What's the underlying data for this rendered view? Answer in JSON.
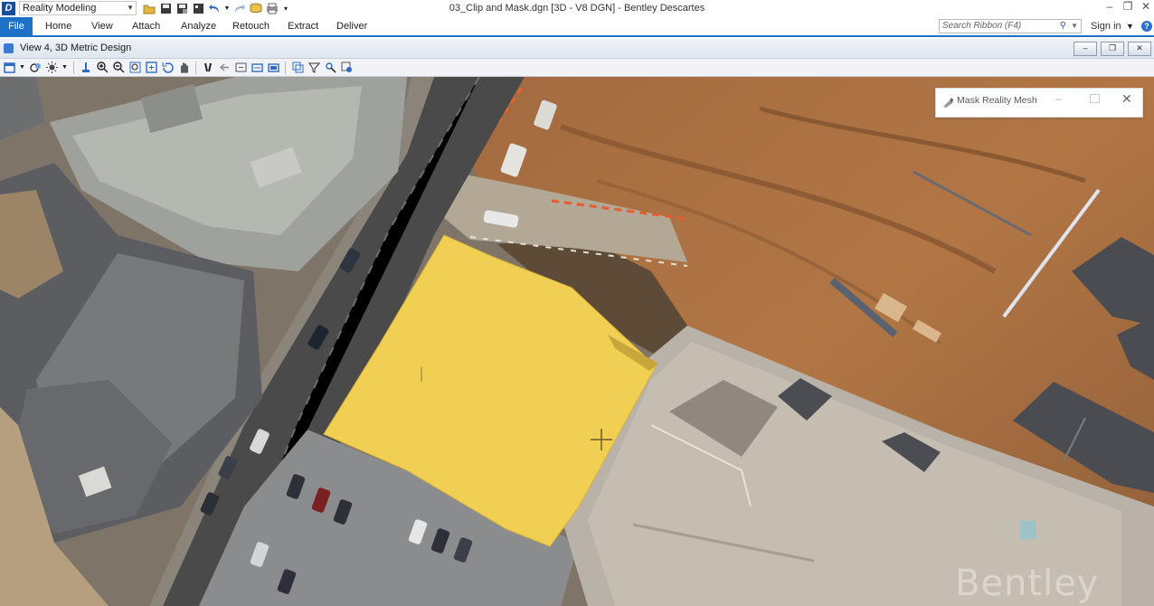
{
  "window": {
    "title": "03_Clip and Mask.dgn [3D - V8 DGN] - Bentley Descartes",
    "workflow": "Reality Modeling",
    "controls": [
      "minimize",
      "restore",
      "close"
    ]
  },
  "ribbon": {
    "tabs": [
      "File",
      "Home",
      "View",
      "Attach",
      "Analyze",
      "Retouch",
      "Extract",
      "Deliver"
    ],
    "active_tab": "File",
    "search_placeholder": "Search Ribbon (F4)",
    "sign_in": "Sign in"
  },
  "view": {
    "title": "View 4, 3D Metric Design"
  },
  "dialog": {
    "title": "Mask Reality Mesh"
  },
  "watermark": "Bentley",
  "colors": {
    "accent": "#1d72c8",
    "mask_fill": "#f1cf52",
    "terrain": "#a8703f"
  },
  "icons": {
    "quick_access": [
      "folder-open-icon",
      "save-icon",
      "save-as-icon",
      "properties-icon",
      "undo-icon",
      "undo-dropdown-icon",
      "redo-icon",
      "stack-icon",
      "print-icon",
      "customize-icon"
    ],
    "view_tools": [
      "view-attributes-icon",
      "display-style-icon",
      "lighting-icon",
      "dropdown-icon",
      "place-marker-icon",
      "zoom-in-icon",
      "zoom-out-icon",
      "zoom-window-icon",
      "fit-view-icon",
      "rotate-view-icon",
      "pan-icon",
      "walk-icon",
      "previous-view-icon",
      "next-view-icon",
      "copy-view-icon",
      "camera-icon",
      "window-area-icon",
      "clip-volume-icon",
      "filter-icon",
      "navigate-icon",
      "toggle-icon"
    ]
  }
}
